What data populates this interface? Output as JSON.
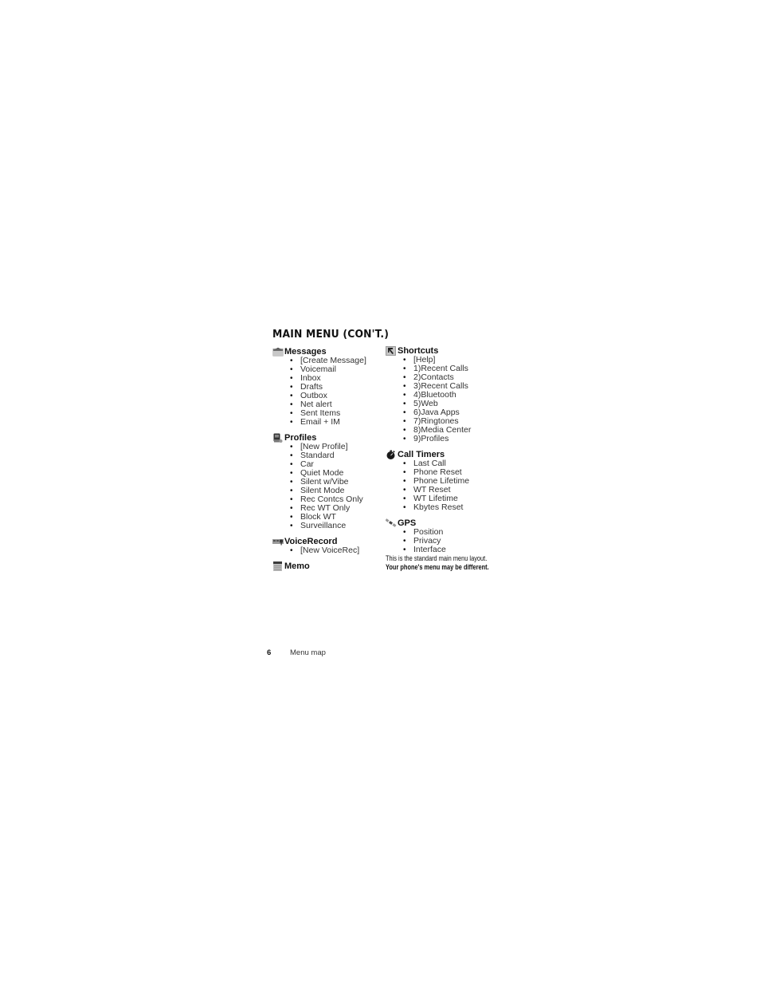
{
  "page": {
    "title": "MAIN MENU (CON'T.)",
    "page_number": "6",
    "footer_title": "Menu map"
  },
  "left_column": [
    {
      "icon": "messages-icon",
      "heading": "Messages",
      "items": [
        "[Create Message]",
        "Voicemail",
        "Inbox",
        "Drafts",
        "Outbox",
        "Net alert",
        "Sent Items",
        "Email + IM"
      ]
    },
    {
      "icon": "profiles-icon",
      "heading": "Profiles",
      "items": [
        "[New Profile]",
        "Standard",
        "Car",
        "Quiet Mode",
        "Silent w/Vibe",
        "Silent Mode",
        "Rec Contcs Only",
        "Rec WT Only",
        "Block WT",
        "Surveillance"
      ]
    },
    {
      "icon": "voicerecord-icon",
      "heading": "VoiceRecord",
      "items": [
        "[New VoiceRec]"
      ]
    },
    {
      "icon": "memo-icon",
      "heading": "Memo",
      "items": []
    }
  ],
  "right_column": [
    {
      "icon": "shortcuts-icon",
      "heading": "Shortcuts",
      "items": [
        "[Help]",
        "1)Recent Calls",
        "2)Contacts",
        "3)Recent Calls",
        "4)Bluetooth",
        "5)Web",
        "6)Java Apps",
        "7)Ringtones",
        "8)Media Center",
        "9)Profiles"
      ]
    },
    {
      "icon": "stopwatch-icon",
      "heading": "Call Timers",
      "items": [
        "Last Call",
        "Phone Reset",
        "Phone Lifetime",
        "WT Reset",
        "WT Lifetime",
        "Kbytes Reset"
      ]
    },
    {
      "icon": "satellite-icon",
      "heading": "GPS",
      "items": [
        "Position",
        "Privacy",
        "Interface"
      ]
    }
  ],
  "notes": {
    "line1": "This is the standard main menu layout.",
    "line2": "Your phone's menu may be different."
  }
}
